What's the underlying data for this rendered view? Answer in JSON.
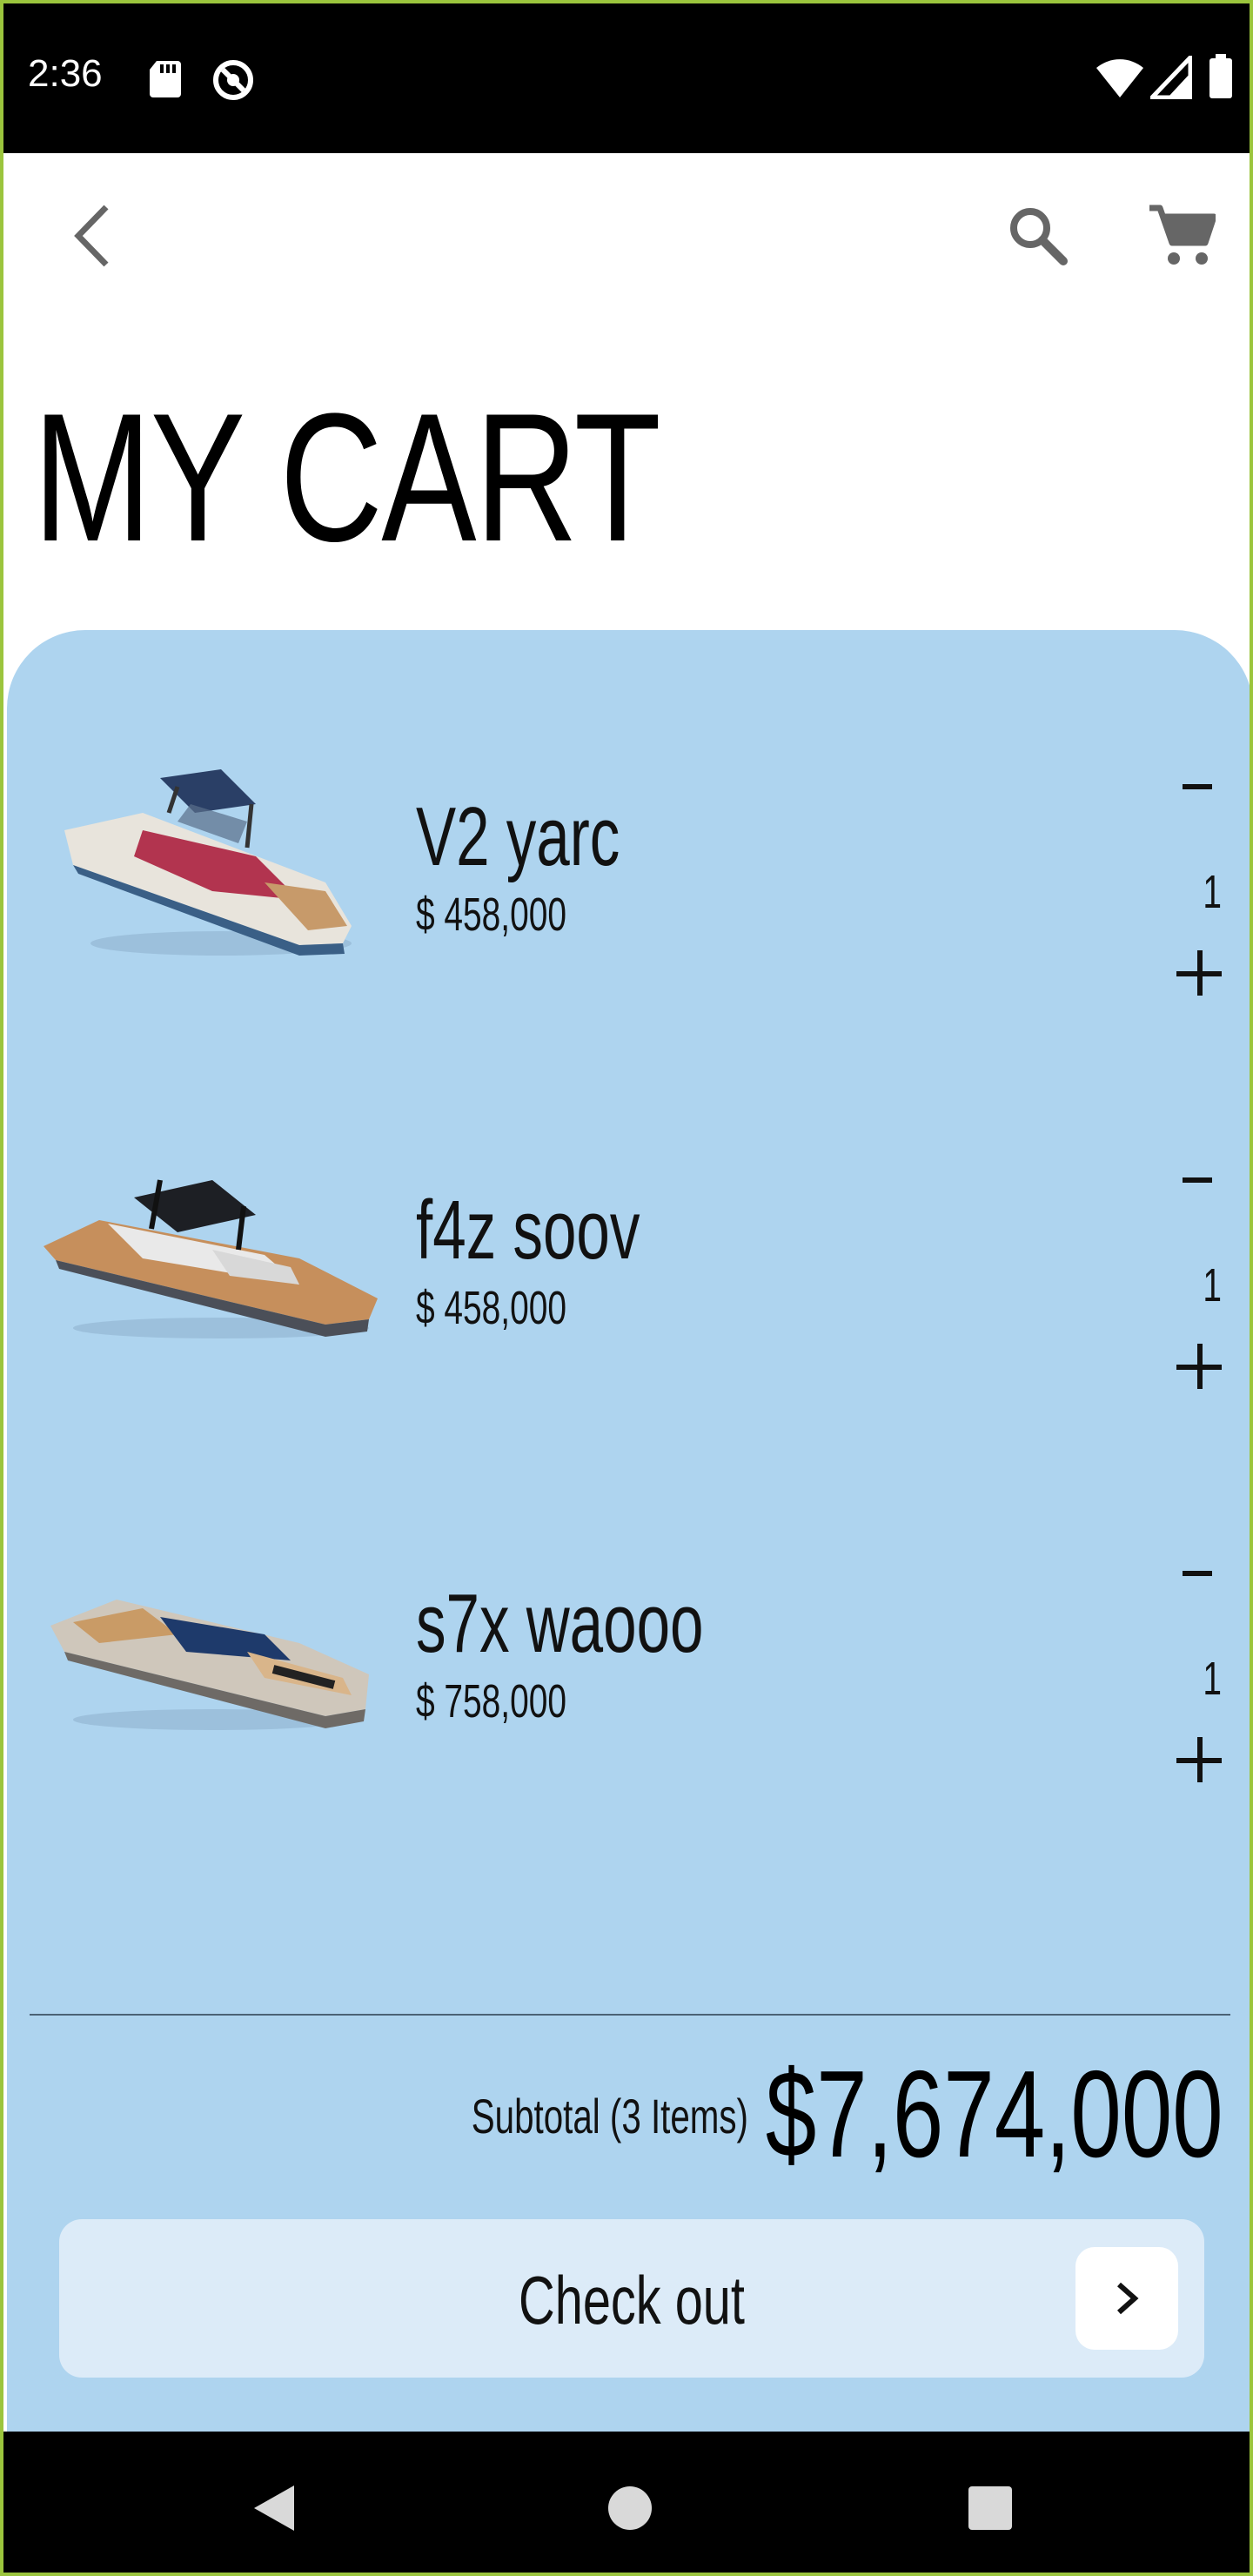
{
  "status_bar": {
    "time": "2:36",
    "icons": [
      "sd-card-icon",
      "sync-disabled-icon",
      "wifi-icon",
      "signal-icon",
      "battery-icon"
    ]
  },
  "app_bar": {
    "back_icon": "chevron-left-icon",
    "search_icon": "search-icon",
    "cart_icon": "shopping-cart-icon"
  },
  "page": {
    "title": "MY CART"
  },
  "cart": {
    "items": [
      {
        "name": "V2 yarc",
        "price": "$ 458,000",
        "quantity": "1",
        "minus": "-",
        "plus": "+"
      },
      {
        "name": "f4z soov",
        "price": "$ 458,000",
        "quantity": "1",
        "minus": "-",
        "plus": "+"
      },
      {
        "name": "s7x waooo",
        "price": "$ 758,000",
        "quantity": "1",
        "minus": "-",
        "plus": "+"
      }
    ],
    "subtotal_label": "Subtotal (3 Items)",
    "subtotal_value": "$7,674,000",
    "checkout_label": "Check out"
  },
  "colors": {
    "panel": "#AED4EF",
    "checkout_bg": "#DCEBF8",
    "frame_border": "#9BC53D"
  },
  "nav_bar": {
    "icons": [
      "back-triangle-icon",
      "home-circle-icon",
      "recents-square-icon"
    ]
  }
}
